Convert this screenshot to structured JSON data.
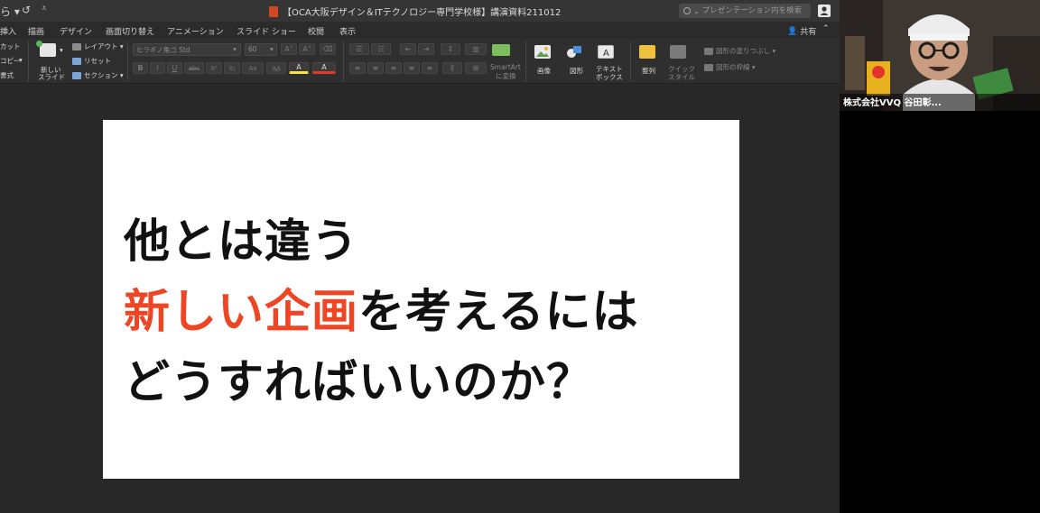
{
  "title_bar": {
    "undo_icon": "undo-icon",
    "redo_icon": "redo-icon",
    "document_title": "【OCA大阪デザイン＆ITテクノロジー専門学校様】講演資料211012",
    "search_placeholder": "プレゼンテーション内を検索",
    "search_chevron": "⌄"
  },
  "tabs": [
    "挿入",
    "描画",
    "デザイン",
    "画面切り替え",
    "アニメーション",
    "スライド ショー",
    "校閲",
    "表示"
  ],
  "share_label": "共有",
  "collapse_glyph": "⌃",
  "ribbon": {
    "clipboard": {
      "cut": "カット",
      "copy": "コピー",
      "format": "書式"
    },
    "slides": {
      "new_slide_line1": "新しい",
      "new_slide_line2": "スライド",
      "layout": "レイアウト",
      "reset": "リセット",
      "section": "セクション"
    },
    "font": {
      "name_placeholder": "ヒラギノ角ゴ Std",
      "size_placeholder": "60",
      "bold": "B",
      "italic": "I",
      "underline": "U",
      "strike": "abc",
      "superscript": "X²",
      "subscript": "X₂",
      "font_case": "Aa",
      "highlight": "A",
      "font_color": "A"
    },
    "paragraph": {
      "smartart_line1": "SmartArt",
      "smartart_line2": "に変換"
    },
    "insert": {
      "image": "画像",
      "shape": "図形",
      "textbox_line1": "テキスト",
      "textbox_line2": "ボックス"
    },
    "drawing": {
      "arrange": "整列",
      "quick_style_line1": "クイック",
      "quick_style_line2": "スタイル",
      "shape_fill": "図形の塗りつぶし",
      "shape_outline": "図形の枠線"
    }
  },
  "slide": {
    "line1": "他とは違う",
    "line2_accent": "新しい企画",
    "line2_rest": "を考えるには",
    "line3": "どうすればいいのか？",
    "accent_color": "#ee4524",
    "text_color": "#111111"
  },
  "video_participant": {
    "name": "株式会社VVQ 谷田彰..."
  },
  "colors": {
    "app_background": "#2b2b2b",
    "ribbon_background": "#2f2f2f",
    "slide_background": "#ffffff",
    "office_red": "#d24726"
  }
}
